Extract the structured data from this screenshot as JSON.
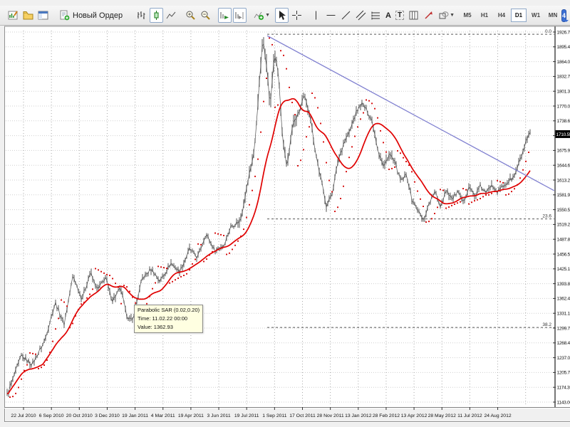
{
  "toolbar": {
    "new_order_label": "Новый Ордер",
    "text_tool_glyph": "A",
    "label_tool_glyph": "T",
    "community_badge": "4",
    "timeframes": [
      {
        "label": "M5",
        "active": false
      },
      {
        "label": "H1",
        "active": false
      },
      {
        "label": "H4",
        "active": false
      },
      {
        "label": "D1",
        "active": true
      },
      {
        "label": "W1",
        "active": false
      },
      {
        "label": "MN",
        "active": false
      }
    ]
  },
  "tooltip": {
    "line1": "Parabolic SAR (0.02,0.20)",
    "line2": "Time: 11.02.22 00:00",
    "line3": "Value: 1362.93"
  },
  "price_axis": {
    "current": "1710.55",
    "ticks": [
      "1926.75",
      "1895.40",
      "1864.05",
      "1832.70",
      "1801.35",
      "1770.00",
      "1738.65",
      "1707.30",
      "1675.95",
      "1644.60",
      "1613.25",
      "1581.90",
      "1550.55",
      "1519.20",
      "1487.85",
      "1456.50",
      "1425.15",
      "1393.80",
      "1362.45",
      "1331.10",
      "1299.75",
      "1268.40",
      "1237.05",
      "1205.70",
      "1174.35",
      "1143.00"
    ]
  },
  "time_axis": {
    "labels": [
      "22 Jul 2010",
      "6 Sep 2010",
      "20 Oct 2010",
      "3 Dec 2010",
      "19 Jan 2011",
      "4 Mar 2011",
      "19 Apr 2011",
      "3 Jun 2011",
      "19 Jul 2011",
      "1 Sep 2011",
      "17 Oct 2011",
      "28 Nov 2011",
      "13 Jan 2012",
      "28 Feb 2012",
      "13 Apr 2012",
      "28 May 2012",
      "11 Jul 2012",
      "24 Aug 2012"
    ]
  },
  "chart_data": {
    "type": "line",
    "title": "",
    "xlabel": "",
    "ylabel": "",
    "x_labels": [
      "22 Jul 2010",
      "6 Sep 2010",
      "20 Oct 2010",
      "3 Dec 2010",
      "19 Jan 2011",
      "4 Mar 2011",
      "19 Apr 2011",
      "3 Jun 2011",
      "19 Jul 2011",
      "1 Sep 2011",
      "17 Oct 2011",
      "28 Nov 2011",
      "13 Jan 2012",
      "28 Feb 2012",
      "13 Apr 2012",
      "28 May 2012",
      "11 Jul 2012",
      "24 Aug 2012"
    ],
    "ylim": [
      1143.0,
      1926.75
    ],
    "current_price": 1710.55,
    "series": [
      {
        "name": "price-close-approx",
        "points": [
          [
            0,
            1158
          ],
          [
            0.027,
            1241
          ],
          [
            0.048,
            1223
          ],
          [
            0.071,
            1271
          ],
          [
            0.092,
            1354
          ],
          [
            0.109,
            1309
          ],
          [
            0.126,
            1411
          ],
          [
            0.143,
            1361
          ],
          [
            0.159,
            1417
          ],
          [
            0.173,
            1380
          ],
          [
            0.188,
            1407
          ],
          [
            0.201,
            1358
          ],
          [
            0.217,
            1384
          ],
          [
            0.228,
            1328
          ],
          [
            0.239,
            1313
          ],
          [
            0.258,
            1404
          ],
          [
            0.276,
            1425
          ],
          [
            0.292,
            1399
          ],
          [
            0.313,
            1437
          ],
          [
            0.33,
            1419
          ],
          [
            0.349,
            1467
          ],
          [
            0.364,
            1449
          ],
          [
            0.38,
            1500
          ],
          [
            0.397,
            1464
          ],
          [
            0.414,
            1475
          ],
          [
            0.428,
            1515
          ],
          [
            0.446,
            1527
          ],
          [
            0.459,
            1603
          ],
          [
            0.473,
            1678
          ],
          [
            0.482,
            1814
          ],
          [
            0.489,
            1912
          ],
          [
            0.496,
            1859
          ],
          [
            0.503,
            1768
          ],
          [
            0.511,
            1882
          ],
          [
            0.519,
            1836
          ],
          [
            0.527,
            1693
          ],
          [
            0.535,
            1640
          ],
          [
            0.546,
            1731
          ],
          [
            0.557,
            1753
          ],
          [
            0.568,
            1791
          ],
          [
            0.579,
            1753
          ],
          [
            0.59,
            1670
          ],
          [
            0.601,
            1610
          ],
          [
            0.611,
            1557
          ],
          [
            0.622,
            1588
          ],
          [
            0.633,
            1655
          ],
          [
            0.644,
            1693
          ],
          [
            0.655,
            1716
          ],
          [
            0.666,
            1753
          ],
          [
            0.677,
            1776
          ],
          [
            0.688,
            1761
          ],
          [
            0.698,
            1738
          ],
          [
            0.709,
            1678
          ],
          [
            0.72,
            1640
          ],
          [
            0.731,
            1670
          ],
          [
            0.742,
            1648
          ],
          [
            0.753,
            1610
          ],
          [
            0.764,
            1625
          ],
          [
            0.774,
            1572
          ],
          [
            0.785,
            1550
          ],
          [
            0.796,
            1527
          ],
          [
            0.807,
            1565
          ],
          [
            0.818,
            1588
          ],
          [
            0.829,
            1557
          ],
          [
            0.84,
            1595
          ],
          [
            0.851,
            1572
          ],
          [
            0.861,
            1588
          ],
          [
            0.872,
            1565
          ],
          [
            0.883,
            1600
          ],
          [
            0.894,
            1580
          ],
          [
            0.905,
            1600
          ],
          [
            0.916,
            1585
          ],
          [
            0.927,
            1606
          ],
          [
            0.938,
            1588
          ],
          [
            0.948,
            1600
          ],
          [
            0.959,
            1610
          ],
          [
            0.97,
            1621
          ],
          [
            0.981,
            1655
          ],
          [
            0.992,
            1693
          ],
          [
            1,
            1711
          ]
        ]
      }
    ],
    "indicators": [
      {
        "name": "Parabolic SAR",
        "params": [
          0.02,
          0.2
        ],
        "style": "dots",
        "color": "#d40000"
      },
      {
        "name": "Moving Average",
        "style": "line",
        "color": "#e00000"
      }
    ],
    "overlays": {
      "trendline": {
        "color": "#8080d0",
        "from": {
          "t": 0.496,
          "price": 1919
        },
        "to": {
          "t": 1.043,
          "price": 1591
        }
      },
      "fibonacci": {
        "color": "#555555",
        "start_t": 0.496,
        "levels": [
          {
            "label": "0.0",
            "price": 1922.0
          },
          {
            "label": "23.6",
            "price": 1531.0
          },
          {
            "label": "38.2",
            "price": 1301.0
          }
        ]
      }
    },
    "legend_position": "none",
    "grid": "dotted"
  },
  "colors": {
    "bars": "#6a6a6a",
    "ma": "#e00000",
    "sar": "#d40000",
    "trendline": "#8080d0",
    "fib": "#555555",
    "badge_bg": "#000000",
    "badge_text": "#ffffff",
    "tooltip_bg": "#ffffe1",
    "active_button_border": "#8fa8c8"
  }
}
